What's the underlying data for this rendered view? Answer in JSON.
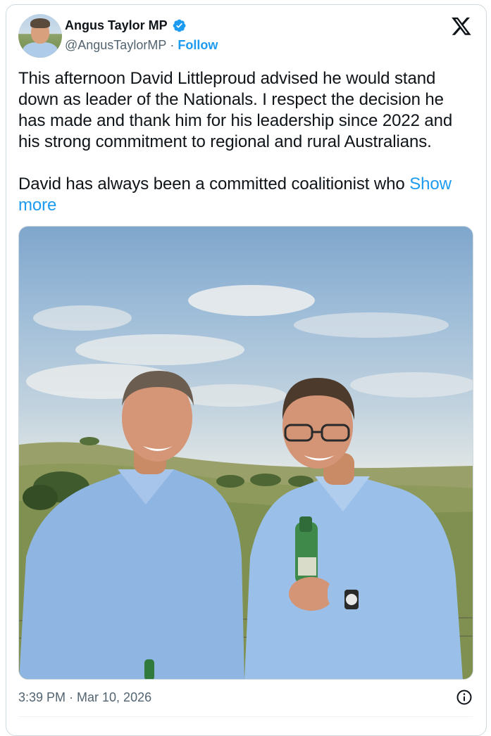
{
  "author": {
    "display_name": "Angus Taylor MP",
    "handle": "@AngusTaylorMP",
    "separator": "·",
    "follow_label": "Follow",
    "verified_icon": "verified-badge-icon",
    "verified_color": "#1d9bf0"
  },
  "platform": {
    "logo_icon": "x-logo-icon"
  },
  "tweet": {
    "paragraph_1": "This afternoon David Littleproud advised he would stand down as leader of the Nationals. I respect the decision he has made and thank him for his leadership since 2022 and his strong commitment to regional and rural Australians.",
    "paragraph_2": "David has always been a committed coalitionist who ",
    "show_more_label": "Show more"
  },
  "media": {
    "type": "photo",
    "icon": "photo-image"
  },
  "footer": {
    "timestamp": "3:39 PM · Mar 10, 2026",
    "info_icon": "info-icon"
  },
  "colors": {
    "link": "#1d9bf0",
    "text": "#0f1419",
    "secondary": "#536471",
    "border": "#cfd9de"
  }
}
